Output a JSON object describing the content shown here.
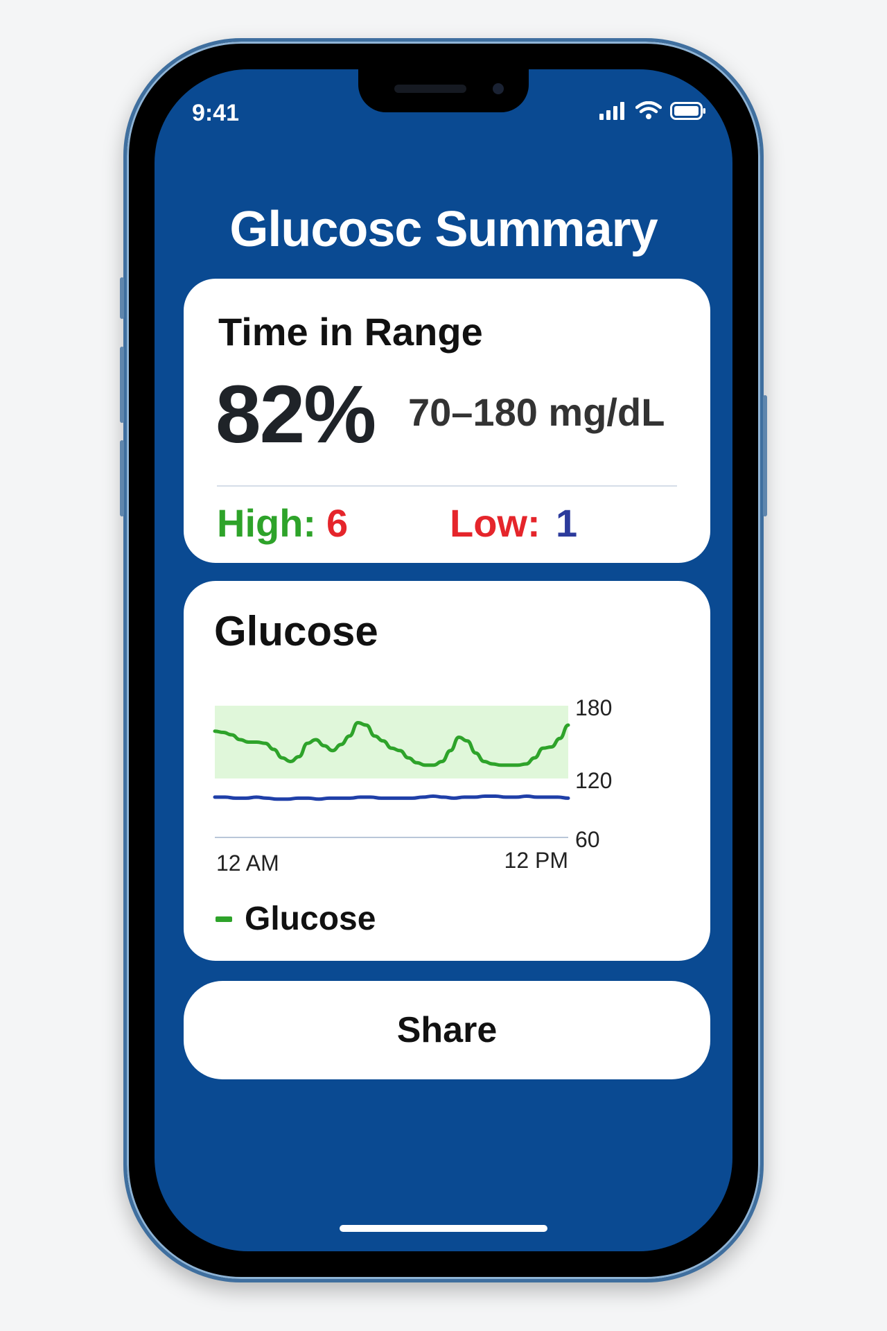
{
  "status_bar": {
    "time": "9:41"
  },
  "page": {
    "title": "Glucosc Summary"
  },
  "time_in_range": {
    "title": "Time in Range",
    "value": "82%",
    "range": "70–180 mg/dL",
    "high_label": "High:",
    "high_value": "6",
    "low_label": "Low:",
    "low_value": "1"
  },
  "glucose_card": {
    "title": "Glucose",
    "legend_label": "Glucose"
  },
  "share_button": {
    "label": "Share"
  },
  "colors": {
    "background": "#0a4a92",
    "in_range_band": "#e0f7da",
    "glucose_line": "#2ea32a",
    "baseline_line": "#1f3fa8",
    "high": "#2ea32a",
    "low": "#e5252b"
  },
  "chart_data": {
    "type": "line",
    "x_ticks": [
      "12 AM",
      "12 PM"
    ],
    "y_ticks": [
      180,
      120,
      60
    ],
    "ylim": [
      60,
      180
    ],
    "target_band": [
      120,
      180
    ],
    "legend": "Glucose",
    "series": [
      {
        "name": "Glucose",
        "color": "#2ea32a",
        "values": [
          159,
          158,
          156,
          152,
          150,
          150,
          149,
          144,
          137,
          134,
          138,
          149,
          152,
          147,
          143,
          148,
          155,
          166,
          164,
          155,
          151,
          145,
          143,
          137,
          133,
          131,
          131,
          134,
          143,
          154,
          151,
          141,
          134,
          132,
          131,
          131,
          131,
          132,
          137,
          145,
          146,
          153,
          164
        ]
      },
      {
        "values": [
          101,
          101,
          100,
          100,
          101,
          100,
          99,
          99,
          100,
          100,
          99,
          100,
          100,
          100,
          101,
          101,
          100,
          100,
          100,
          100,
          101,
          102,
          101,
          100,
          101,
          101,
          102,
          102,
          101,
          101,
          102,
          101,
          101,
          101,
          100
        ]
      }
    ]
  }
}
